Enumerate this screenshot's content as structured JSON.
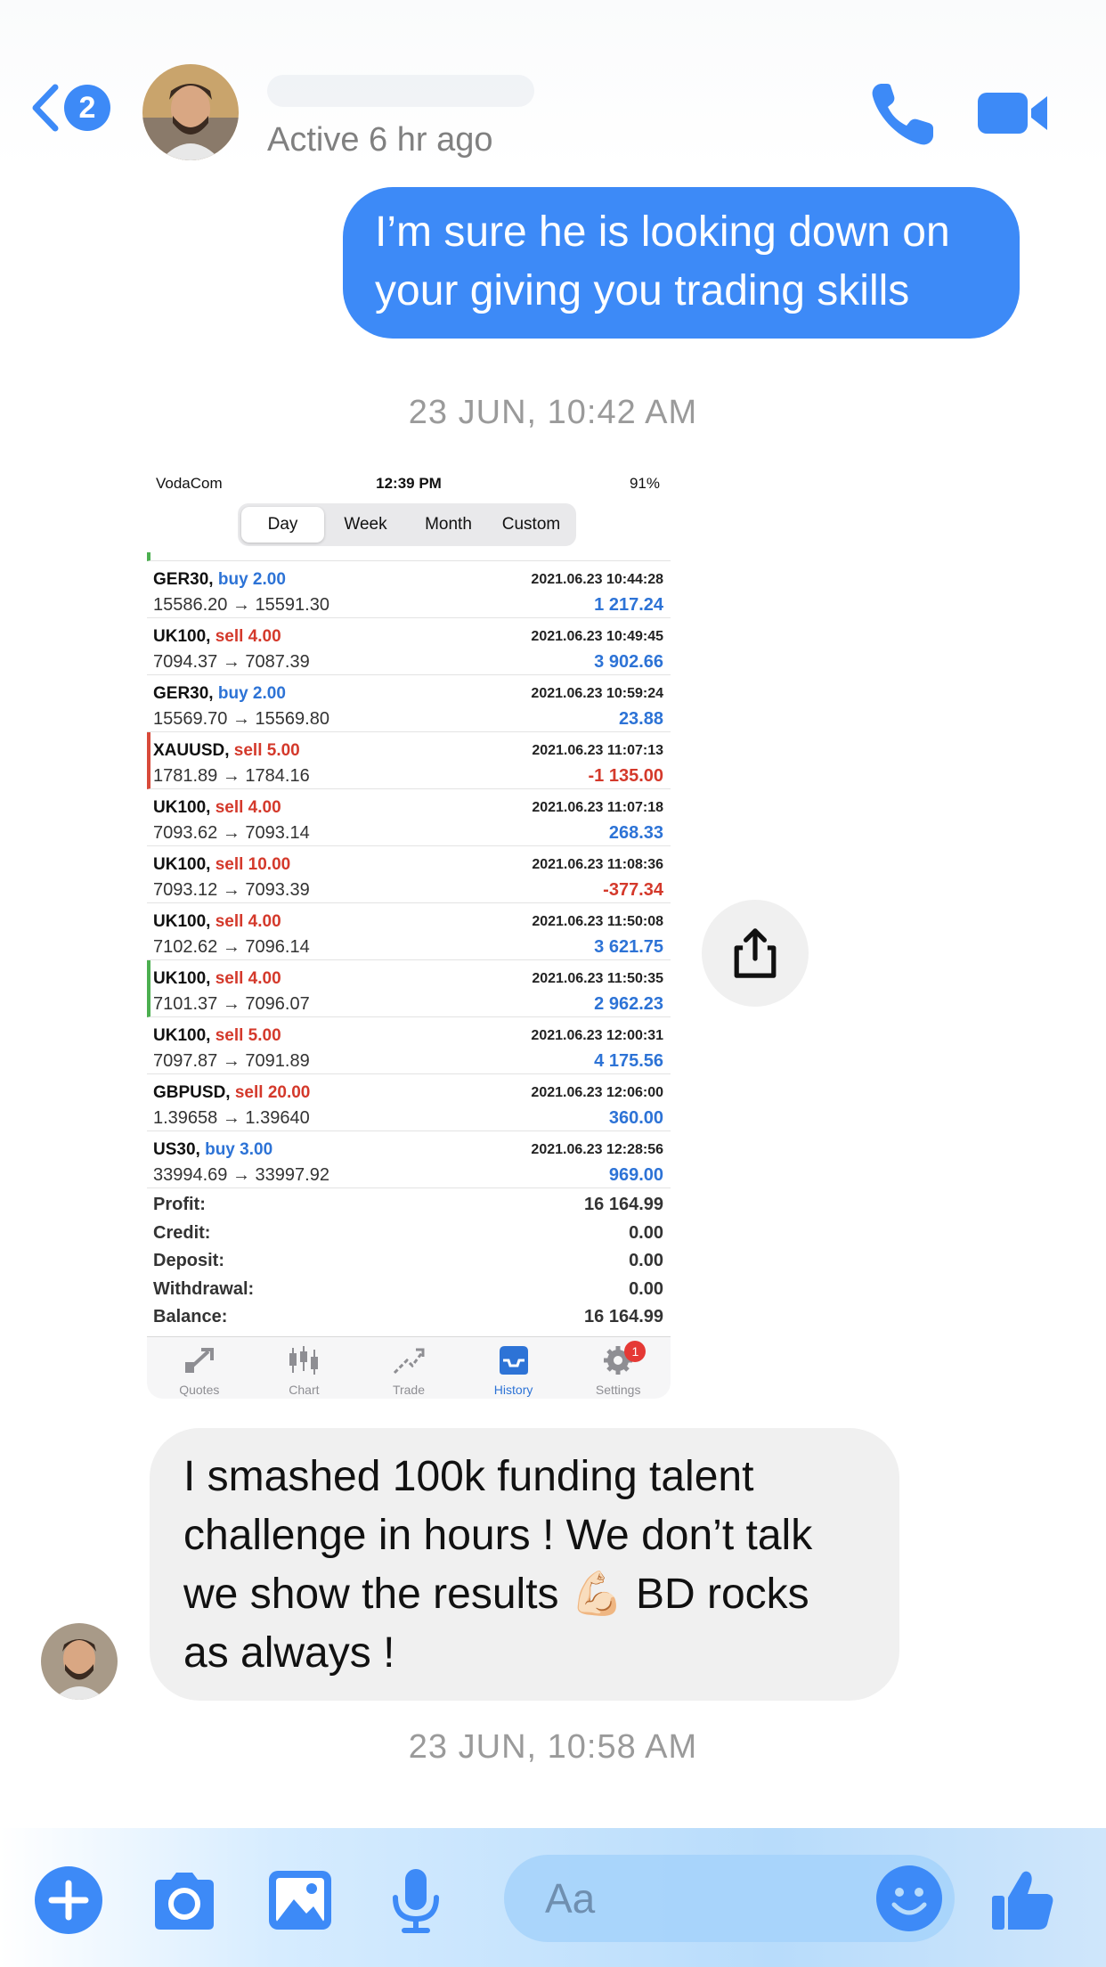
{
  "header": {
    "back_badge": "2",
    "active_status": "Active 6 hr ago"
  },
  "messages": {
    "outgoing_text": "I’m sure he is looking down on your giving you trading skills",
    "timestamp_1": "23 JUN, 10:42 AM",
    "incoming_text": "I smashed 100k funding talent challenge in hours ! We don’t talk we show the results 💪🏻 BD rocks as always !",
    "timestamp_2": "23 JUN, 10:58 AM"
  },
  "screenshot": {
    "status": {
      "carrier": "VodaCom",
      "time": "12:39 PM",
      "battery": "91%"
    },
    "segments": [
      "Day",
      "Week",
      "Month",
      "Custom"
    ],
    "trades": [
      {
        "symbol": "GER30,",
        "dir": "buy 2.00",
        "type": "buy",
        "prices": "15586.20 → 15591.30",
        "date": "2021.06.23 10:44:28",
        "pl": "1 217.24",
        "sign": "pos"
      },
      {
        "symbol": "UK100,",
        "dir": "sell 4.00",
        "type": "sell",
        "prices": "7094.37 → 7087.39",
        "date": "2021.06.23 10:49:45",
        "pl": "3 902.66",
        "sign": "pos"
      },
      {
        "symbol": "GER30,",
        "dir": "buy 2.00",
        "type": "buy",
        "prices": "15569.70 → 15569.80",
        "date": "2021.06.23 10:59:24",
        "pl": "23.88",
        "sign": "pos"
      },
      {
        "symbol": "XAUUSD,",
        "dir": "sell 5.00",
        "type": "sell",
        "prices": "1781.89 → 1784.16",
        "date": "2021.06.23 11:07:13",
        "pl": "-1 135.00",
        "sign": "neg",
        "mark": "red"
      },
      {
        "symbol": "UK100,",
        "dir": "sell 4.00",
        "type": "sell",
        "prices": "7093.62 → 7093.14",
        "date": "2021.06.23 11:07:18",
        "pl": "268.33",
        "sign": "pos"
      },
      {
        "symbol": "UK100,",
        "dir": "sell 10.00",
        "type": "sell",
        "prices": "7093.12 → 7093.39",
        "date": "2021.06.23 11:08:36",
        "pl": "-377.34",
        "sign": "neg"
      },
      {
        "symbol": "UK100,",
        "dir": "sell 4.00",
        "type": "sell",
        "prices": "7102.62 → 7096.14",
        "date": "2021.06.23 11:50:08",
        "pl": "3 621.75",
        "sign": "pos"
      },
      {
        "symbol": "UK100,",
        "dir": "sell 4.00",
        "type": "sell",
        "prices": "7101.37 → 7096.07",
        "date": "2021.06.23 11:50:35",
        "pl": "2 962.23",
        "sign": "pos",
        "mark": "green"
      },
      {
        "symbol": "UK100,",
        "dir": "sell 5.00",
        "type": "sell",
        "prices": "7097.87 → 7091.89",
        "date": "2021.06.23 12:00:31",
        "pl": "4 175.56",
        "sign": "pos"
      },
      {
        "symbol": "GBPUSD,",
        "dir": "sell 20.00",
        "type": "sell",
        "prices": "1.39658 → 1.39640",
        "date": "2021.06.23 12:06:00",
        "pl": "360.00",
        "sign": "pos"
      },
      {
        "symbol": "US30,",
        "dir": "buy 3.00",
        "type": "buy",
        "prices": "33994.69 → 33997.92",
        "date": "2021.06.23 12:28:56",
        "pl": "969.00",
        "sign": "pos"
      }
    ],
    "summary": [
      {
        "label": "Profit:",
        "value": "16 164.99"
      },
      {
        "label": "Credit:",
        "value": "0.00"
      },
      {
        "label": "Deposit:",
        "value": "0.00"
      },
      {
        "label": "Withdrawal:",
        "value": "0.00"
      },
      {
        "label": "Balance:",
        "value": "16 164.99"
      }
    ],
    "tabs": [
      {
        "label": "Quotes",
        "icon": "quotes-icon"
      },
      {
        "label": "Chart",
        "icon": "candlestick-icon"
      },
      {
        "label": "Trade",
        "icon": "trade-icon"
      },
      {
        "label": "History",
        "icon": "inbox-icon",
        "active": true
      },
      {
        "label": "Settings",
        "icon": "gear-icon",
        "badge": "1"
      }
    ]
  },
  "composer": {
    "placeholder": "Aa"
  },
  "colors": {
    "accent": "#3d8af7",
    "profit": "#2d73d6",
    "loss": "#d4392b"
  }
}
